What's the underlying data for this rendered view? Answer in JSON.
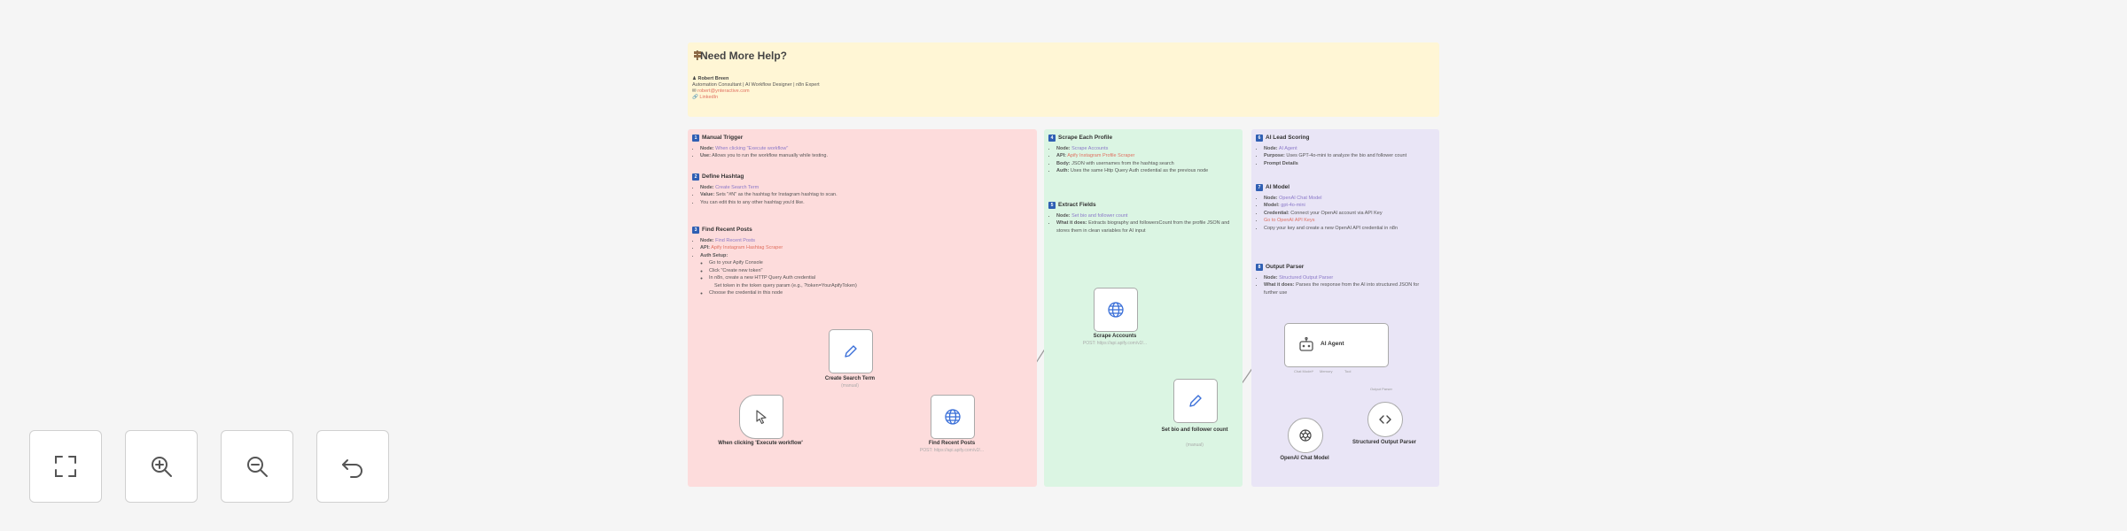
{
  "help": {
    "title": "Need More Help?",
    "name": "Robert Breen",
    "role": "Automation Consultant | AI Workflow Designer | n8n Expert",
    "email": "robert@ynteractive.com",
    "link": "LinkedIn"
  },
  "red": {
    "s1_title": "Manual Trigger",
    "s1_node_k": "Node:",
    "s1_node_v": "When clicking \"Execute workflow\"",
    "s1_use_k": "Use:",
    "s1_use_v": "Allows you to run the workflow manually while testing.",
    "s2_title": "Define Hashtag",
    "s2_node_k": "Node:",
    "s2_node_v": "Create Search Term",
    "s2_value_k": "Value:",
    "s2_value_v": "Sets \"#N\" as the hashtag for Instagram hashtag to scan.",
    "s2_note": "You can edit this to any other hashtag you'd like.",
    "s3_title": "Find Recent Posts",
    "s3_node_k": "Node:",
    "s3_node_v": "Find Recent Posts",
    "s3_api_k": "API:",
    "s3_api_v": "Apify Instagram Hashtag Scraper",
    "s3_auth": "Auth Setup:",
    "s3_a1": "Go to your Apify Console",
    "s3_a2": "Click \"Create new token\"",
    "s3_a3": "In n8n, create a new HTTP Query Auth credential",
    "s3_a4": "Set token in the token query param (e.g., ?token=YourApifyToken)",
    "s3_a5": "Choose the credential in this node"
  },
  "green": {
    "s4_title": "Scrape Each Profile",
    "s4_node_k": "Node:",
    "s4_node_v": "Scrape Accounts",
    "s4_api_k": "API:",
    "s4_api_v": "Apify Instagram Profile Scraper",
    "s4_body_k": "Body:",
    "s4_body_v": "JSON with usernames from the hashtag search",
    "s4_auth_k": "Auth:",
    "s4_auth_v": "Uses the same Http Query Auth credential as the previous node",
    "s5_title": "Extract Fields",
    "s5_node_k": "Node:",
    "s5_node_v": "Set bio and follower count",
    "s5_what_k": "What it does:",
    "s5_what_v": "Extracts biography and followersCount from the profile JSON and stores them in clean variables for AI input"
  },
  "purple": {
    "s6_title": "AI Lead Scoring",
    "s6_node_k": "Node:",
    "s6_node_v": "AI Agent",
    "s6_purpose_k": "Purpose:",
    "s6_purpose_v": "Uses GPT-4o-mini to analyze the bio and follower count",
    "s6_prompt": "Prompt Details",
    "s7_title": "AI Model",
    "s7_node_k": "Node:",
    "s7_node_v": "OpenAI Chat Model",
    "s7_model_k": "Model:",
    "s7_model_v": "gpt-4o-mini",
    "s7_cred_k": "Credential:",
    "s7_cred_v": "Connect your OpenAI account via API Key",
    "s7_b1": "Go to OpenAI API Keys",
    "s7_b2": "Copy your key and create a new OpenAI API credential in n8n",
    "s8_title": "Output Parser",
    "s8_node_k": "Node:",
    "s8_node_v": "Structured Output Parser",
    "s8_what_k": "What it does:",
    "s8_what_v": "Parses the response from the AI into structured JSON for further use"
  },
  "nodes": {
    "trigger_label": "When clicking 'Execute workflow'",
    "create_label": "Create Search Term",
    "create_sub": "(manual)",
    "find_label": "Find Recent Posts",
    "find_sub": "POST: https://api.apify.com/v2/...",
    "scrape_label": "Scrape Accounts",
    "scrape_sub": "POST: https://api.apify.com/v2/...",
    "setbio_label": "Set bio and follower count",
    "setbio_sub": "(manual)",
    "agent_label": "AI Agent",
    "chat_label": "OpenAI Chat Model",
    "parser_label": "Structured Output Parser",
    "port1": "Chat Model*",
    "port2": "Memory",
    "port3": "Tool",
    "port4": "Output Parser"
  },
  "colors": {
    "red_note": "#fddcdc",
    "green_note": "#dbf5e3",
    "purple_note": "#e9e5f6",
    "yellow_note": "#fff6d5",
    "badge": "#2f5fb3",
    "link": "#e07060"
  }
}
